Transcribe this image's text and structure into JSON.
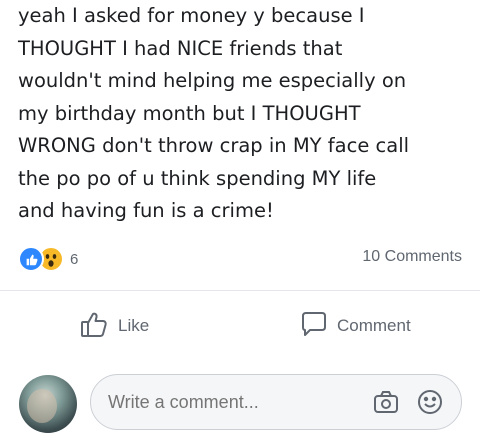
{
  "post": {
    "lines": [
      "yeah I asked for money y because I",
      "THOUGHT I had NICE friends that",
      "wouldn't mind helping me especially on",
      "my birthday month but I THOUGHT",
      "WRONG don't throw crap in MY face call",
      "the po po of u think spending MY life",
      "and having fun is a crime!"
    ]
  },
  "reactions": {
    "count": "6",
    "icons": [
      "like-icon",
      "wow-icon"
    ],
    "like_color": "#2d88ff",
    "wow_color": "#f7b928"
  },
  "comments_count": "10 Comments",
  "actions": {
    "like_label": "Like",
    "comment_label": "Comment"
  },
  "composer": {
    "placeholder": "Write a comment..."
  },
  "colors": {
    "text": "#1c1e21",
    "secondary": "#606770",
    "divider": "#e4e6eb"
  }
}
